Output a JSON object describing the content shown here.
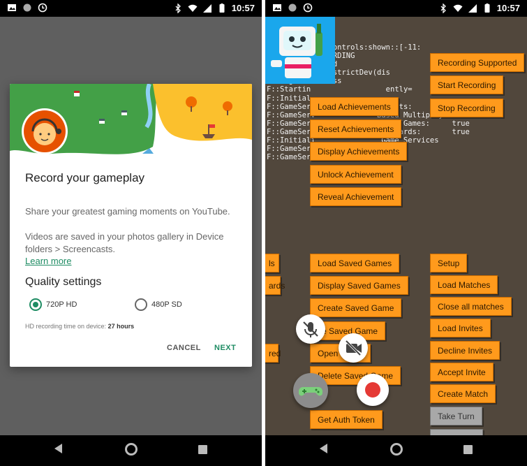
{
  "status_bar": {
    "time": "10:57"
  },
  "left_dialog": {
    "title": "Record your gameplay",
    "paragraph1": "Share your greatest gaming moments on YouTube.",
    "paragraph2": "Videos are saved in your photos gallery in Device folders > Screencasts.",
    "learn_more": "Learn more",
    "quality_title": "Quality settings",
    "option_hd": "720P HD",
    "option_sd": "480P SD",
    "selected_option": "720P HD",
    "hd_time_label": "HD recording time on device:",
    "hd_time_value": "27 hours",
    "cancel": "CANCEL",
    "next": "NEXT"
  },
  "right_screen": {
    "log_lines": [
      "           ng:controls:shown::[-11:",
      "           RECORDING",
      "           oaded",
      "[     596801]districtDev(dis",
      "F::signin:success",
      "F::Startin                 ently=",
      "F::Initial",
      "F::GameServices Supported Quests:         false",
      "F::GameServ              Based Multiplayer: true",
      "F::GameServ                    Games:     true",
      "F::GameServ                  oards:       true",
      "F::Initiali               Game Services",
      "F::GameSer                34",
      "F::GameSer"
    ],
    "top_buttons": [
      "Load Achievements",
      "Reset Achievements",
      "Display Achievements",
      "Unlock Achievement",
      "Reveal Achievement"
    ],
    "right_top_buttons": [
      "Recording Supported",
      "Start Recording",
      "Stop Recording"
    ],
    "left_partial_buttons": [
      "ls",
      "ards",
      "red"
    ],
    "middle_buttons": [
      "Load Saved Games",
      "Display Saved Games",
      "Create Saved Game",
      "ve Saved Game",
      "Open  Game",
      "Delete Saved Game",
      "Get Auth Token"
    ],
    "right_buttons": [
      "Setup",
      "Load Matches",
      "Close all matches",
      "Load Invites",
      "Decline Invites",
      "Accept Invite",
      "Create Match",
      "Take Turn"
    ]
  },
  "colors": {
    "accent_green": "#1e8c63",
    "game_button": "#ff9a1c",
    "record_red": "#e53935",
    "game_bg": "#51473c"
  }
}
